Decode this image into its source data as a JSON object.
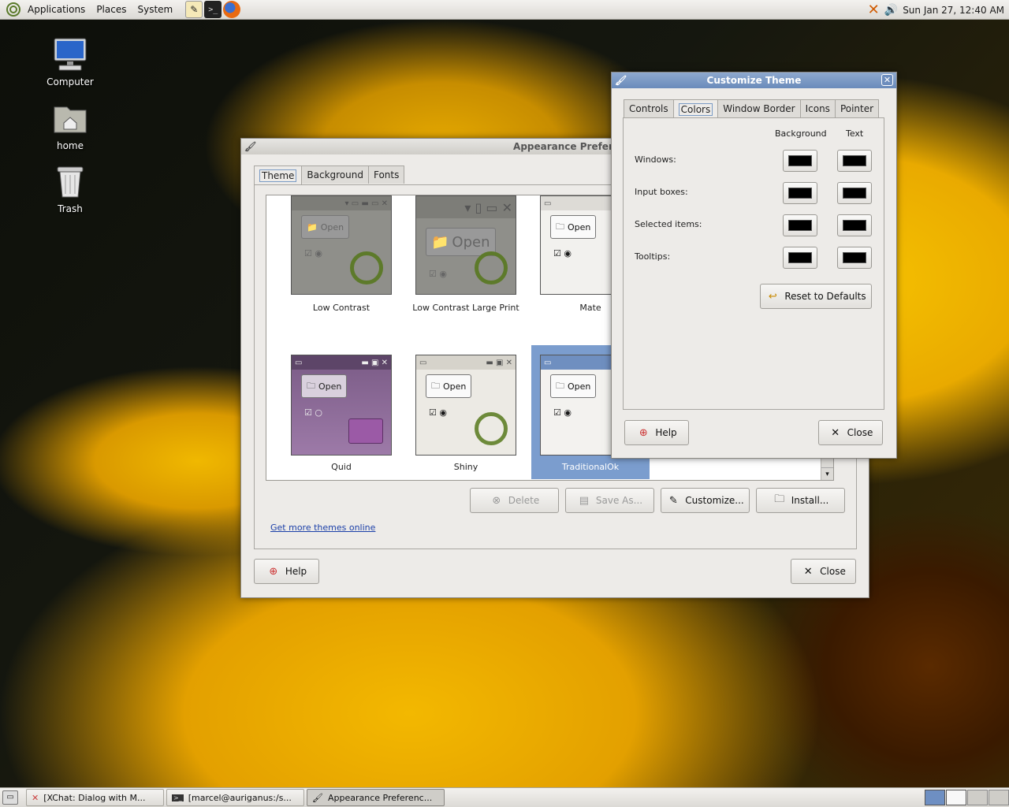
{
  "top_panel": {
    "menus": [
      "Applications",
      "Places",
      "System"
    ],
    "clock": "Sun Jan 27, 12:40 AM",
    "launchers": [
      "text-editor-icon",
      "terminal-icon",
      "firefox-icon"
    ]
  },
  "desktop": {
    "icons": [
      {
        "label": "Computer",
        "icon": "computer-icon"
      },
      {
        "label": "home",
        "icon": "home-folder-icon"
      },
      {
        "label": "Trash",
        "icon": "trash-icon"
      }
    ]
  },
  "appearance": {
    "title": "Appearance Preferences",
    "tabs": [
      "Theme",
      "Background",
      "Fonts"
    ],
    "themes": [
      "Low Contrast",
      "Low Contrast Large Print",
      "Mate",
      "Quid",
      "Shiny",
      "TraditionalOk"
    ],
    "selected_theme": "TraditionalOk",
    "open_label": "Open",
    "buttons": {
      "delete": "Delete",
      "save_as": "Save As...",
      "customize": "Customize...",
      "install": "Install..."
    },
    "link": "Get more themes online",
    "help": "Help",
    "close": "Close"
  },
  "customize": {
    "title": "Customize Theme",
    "tabs": [
      "Controls",
      "Colors",
      "Window Border",
      "Icons",
      "Pointer"
    ],
    "active_tab": "Colors",
    "col_background": "Background",
    "col_text": "Text",
    "rows": [
      "Windows:",
      "Input boxes:",
      "Selected items:",
      "Tooltips:"
    ],
    "reset": "Reset to Defaults",
    "help": "Help",
    "close": "Close",
    "swatch_color": "#000000"
  },
  "taskbar": {
    "tasks": [
      "[XChat: Dialog with M...",
      "[marcel@auriganus:/s...",
      "Appearance Preferenc..."
    ],
    "active_task": 2
  }
}
